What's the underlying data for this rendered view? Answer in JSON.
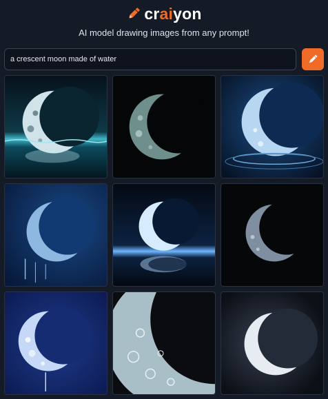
{
  "brand": {
    "pre": "cr",
    "highlight": "ai",
    "post": "yon",
    "accent_color": "#f06a28"
  },
  "tagline": "AI model drawing images from any prompt!",
  "prompt": {
    "value": "a crescent moon made of water",
    "submit_icon": "pencil-icon"
  },
  "results": [
    {
      "index": 1,
      "variant": "cyan-water-reflection"
    },
    {
      "index": 2,
      "variant": "dark-teal-moon"
    },
    {
      "index": 3,
      "variant": "blue-splash-ripple"
    },
    {
      "index": 4,
      "variant": "deep-blue-dripping"
    },
    {
      "index": 5,
      "variant": "glowing-blue-reflection"
    },
    {
      "index": 6,
      "variant": "grey-dark-moon"
    },
    {
      "index": 7,
      "variant": "navy-bubbly-moon"
    },
    {
      "index": 8,
      "variant": "closeup-cratered"
    },
    {
      "index": 9,
      "variant": "silver-glow"
    }
  ]
}
